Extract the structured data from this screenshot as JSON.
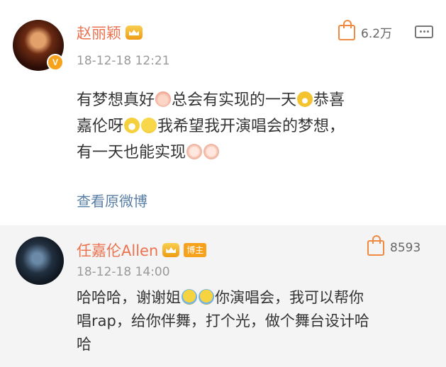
{
  "comments": [
    {
      "name": "赵丽颖",
      "verified_badge": "V",
      "time": "18-12-18 12:21",
      "likes": "6.2万",
      "text_lines": [
        {
          "a": "有梦想真好",
          "b": "总会有实现的一天",
          "c": "恭喜"
        },
        {
          "a": "嘉伦呀",
          "b": "我希望我开演唱会的梦想，"
        },
        {
          "a": "有一天也能实现"
        }
      ],
      "view_original": "查看原微博",
      "icons": [
        "crown-icon",
        "thumb-up-icon",
        "reply-icon",
        "pig-emoji",
        "laugh-emoji",
        "grin-emoji",
        "sad-emoji",
        "cute-emoji"
      ]
    },
    {
      "name": "任嘉伦Allen",
      "tag": "博主",
      "time": "18-12-18 14:00",
      "likes": "8593",
      "text_lines": [
        {
          "a": "哈哈哈，谢谢姐",
          "b": "你演唱会，我可以帮你"
        },
        {
          "a": "唱rap，给你伴舞，打个光，做个舞台设计哈"
        },
        {
          "a": "哈"
        }
      ],
      "icons": [
        "crown-icon",
        "thumb-up-icon",
        "cry-emoji"
      ]
    }
  ],
  "colors": {
    "name": "#eb7350",
    "time": "#999999",
    "link": "#5a7fa5",
    "badge": "#f7a21c",
    "reply_bg": "#f4f4f4"
  }
}
